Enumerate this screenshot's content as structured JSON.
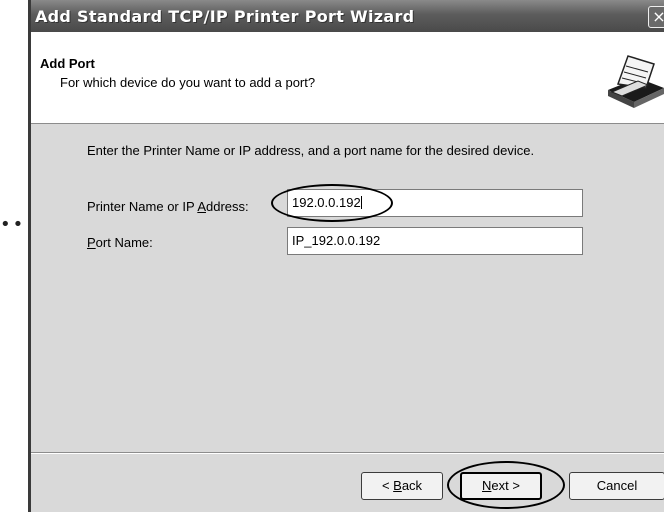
{
  "decoration": {
    "dots": "••"
  },
  "window": {
    "title": "Add Standard TCP/IP Printer Port Wizard",
    "close_glyph": "×"
  },
  "header": {
    "title": "Add Port",
    "subtitle": "For which device do you want to add a port?",
    "icon": "printer-icon"
  },
  "body": {
    "instruction": "Enter the Printer Name or IP address, and a port name for the desired device.",
    "printer_name_label_pre": "Printer Name or IP ",
    "printer_name_label_key": "A",
    "printer_name_label_post": "ddress:",
    "printer_name_value": "192.0.0.192",
    "port_name_label_key": "P",
    "port_name_label_post": "ort Name:",
    "port_name_value": "IP_192.0.0.192"
  },
  "buttons": {
    "back_pre": "< ",
    "back_key": "B",
    "back_post": "ack",
    "next_key": "N",
    "next_post": "ext >",
    "cancel": "Cancel"
  }
}
